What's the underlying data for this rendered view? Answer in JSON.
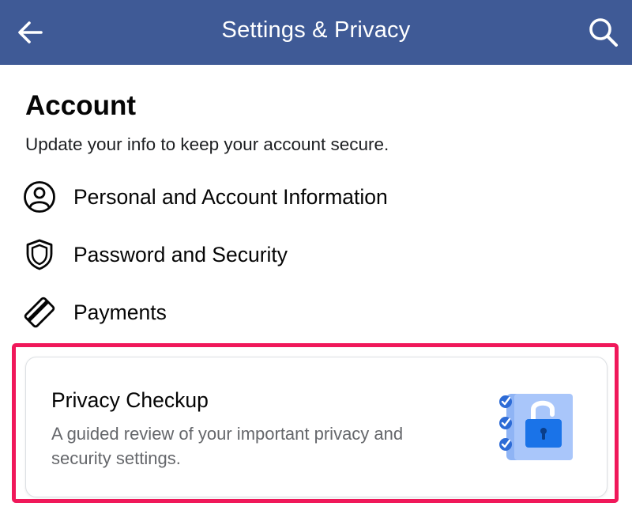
{
  "header": {
    "title": "Settings & Privacy",
    "back_icon": "arrow-left-icon",
    "search_icon": "search-icon",
    "bar_color": "#3f5a96"
  },
  "account": {
    "title": "Account",
    "subtitle": "Update your info to keep your account secure.",
    "items": [
      {
        "label": "Personal and Account Information",
        "icon": "user-circle-icon"
      },
      {
        "label": "Password and Security",
        "icon": "shield-icon"
      },
      {
        "label": "Payments",
        "icon": "credit-card-icon"
      }
    ]
  },
  "privacy_checkup": {
    "title": "Privacy Checkup",
    "description": "A guided review of your important privacy and security settings.",
    "illustration": "checklist-lock-icon",
    "highlight_color": "#f0185a"
  }
}
